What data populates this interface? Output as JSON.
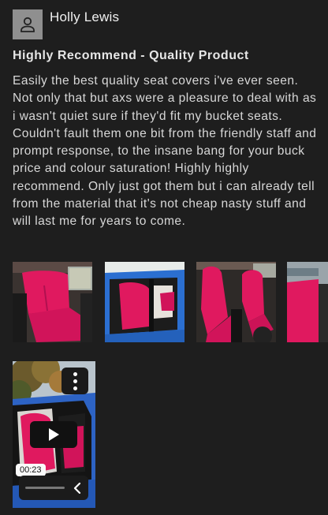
{
  "review": {
    "author": "Holly Lewis",
    "avatar_icon": "user-icon",
    "title": "Highly Recommend - Quality Product",
    "body": "Easily the best quality seat covers i've ever seen. Not only that but axs were a pleasure to deal with as i wasn't quiet sure if they'd fit my bucket seats. Couldn't fault them one bit from the friendly staff and prompt response, to the insane bang for your buck price and colour saturation! Highly highly recommend. Only just got them but i can already tell from the material that it's not cheap nasty stuff and will last me for years to come."
  },
  "media": {
    "photos": [
      {
        "subject": "pink rear seat covers"
      },
      {
        "subject": "pink front seat cover through door"
      },
      {
        "subject": "pink front seat covers"
      },
      {
        "subject": "pink seat cover partial"
      }
    ],
    "video": {
      "duration": "00:23",
      "menu_icon": "more-vertical-icon",
      "play_icon": "play-icon",
      "back_icon": "chevron-left-icon"
    }
  },
  "colors": {
    "background": "#1e1e1e",
    "seat_pink": "#e0195f",
    "text": "#d8d8d8"
  }
}
